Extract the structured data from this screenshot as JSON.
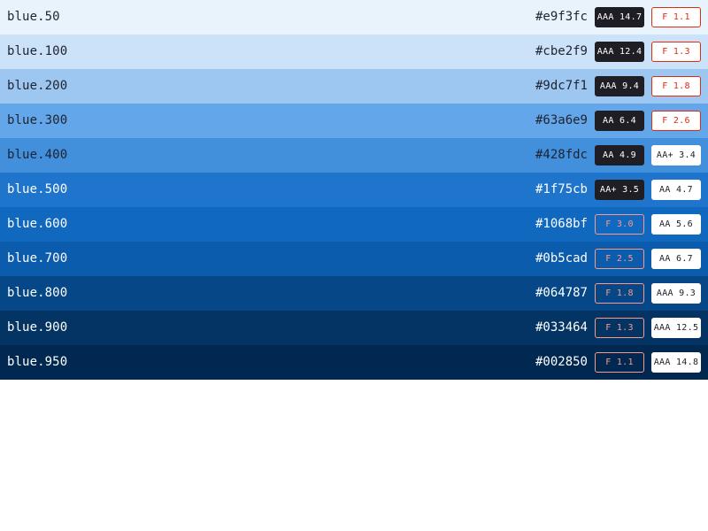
{
  "rows": [
    {
      "name": "blue.50",
      "hex": "#e9f3fc",
      "bg": "#e9f3fc",
      "text_color": "#1f2330",
      "on_dark": {
        "label": "AAA 14.7",
        "pass": true
      },
      "on_light": {
        "label": "F 1.1",
        "pass": false
      }
    },
    {
      "name": "blue.100",
      "hex": "#cbe2f9",
      "bg": "#cbe2f9",
      "text_color": "#1f2330",
      "on_dark": {
        "label": "AAA 12.4",
        "pass": true
      },
      "on_light": {
        "label": "F 1.3",
        "pass": false
      }
    },
    {
      "name": "blue.200",
      "hex": "#9dc7f1",
      "bg": "#9dc7f1",
      "text_color": "#1f2330",
      "on_dark": {
        "label": "AAA 9.4",
        "pass": true
      },
      "on_light": {
        "label": "F 1.8",
        "pass": false
      }
    },
    {
      "name": "blue.300",
      "hex": "#63a6e9",
      "bg": "#63a6e9",
      "text_color": "#1f2330",
      "on_dark": {
        "label": "AA 6.4",
        "pass": true
      },
      "on_light": {
        "label": "F 2.6",
        "pass": false
      }
    },
    {
      "name": "blue.400",
      "hex": "#428fdc",
      "bg": "#428fdc",
      "text_color": "#1f2330",
      "on_dark": {
        "label": "AA 4.9",
        "pass": true
      },
      "on_light": {
        "label": "AA+ 3.4",
        "pass": true
      }
    },
    {
      "name": "blue.500",
      "hex": "#1f75cb",
      "bg": "#1f75cb",
      "text_color": "#ffffff",
      "on_dark": {
        "label": "AA+ 3.5",
        "pass": true
      },
      "on_light": {
        "label": "AA 4.7",
        "pass": true
      }
    },
    {
      "name": "blue.600",
      "hex": "#1068bf",
      "bg": "#1068bf",
      "text_color": "#ffffff",
      "on_dark": {
        "label": "F 3.0",
        "pass": false
      },
      "on_light": {
        "label": "AA 5.6",
        "pass": true
      }
    },
    {
      "name": "blue.700",
      "hex": "#0b5cad",
      "bg": "#0b5cad",
      "text_color": "#ffffff",
      "on_dark": {
        "label": "F 2.5",
        "pass": false
      },
      "on_light": {
        "label": "AA 6.7",
        "pass": true
      }
    },
    {
      "name": "blue.800",
      "hex": "#064787",
      "bg": "#064787",
      "text_color": "#ffffff",
      "on_dark": {
        "label": "F 1.8",
        "pass": false
      },
      "on_light": {
        "label": "AAA 9.3",
        "pass": true
      }
    },
    {
      "name": "blue.900",
      "hex": "#033464",
      "bg": "#033464",
      "text_color": "#ffffff",
      "on_dark": {
        "label": "F 1.3",
        "pass": false
      },
      "on_light": {
        "label": "AAA 12.5",
        "pass": true
      }
    },
    {
      "name": "blue.950",
      "hex": "#002850",
      "bg": "#002850",
      "text_color": "#ffffff",
      "on_dark": {
        "label": "F 1.1",
        "pass": false
      },
      "on_light": {
        "label": "AAA 14.8",
        "pass": true
      }
    }
  ],
  "colors": {
    "dark_badge_bg": "#1f1e24",
    "dark_badge_text_pass": "#ffffff",
    "light_badge_bg": "#ffffff",
    "light_badge_text_pass": "#1f1e24",
    "fail_text": "#dd2b0e",
    "fail_text_on_dark": "#fc9a8a",
    "fail_border": "#dd2b0e"
  }
}
